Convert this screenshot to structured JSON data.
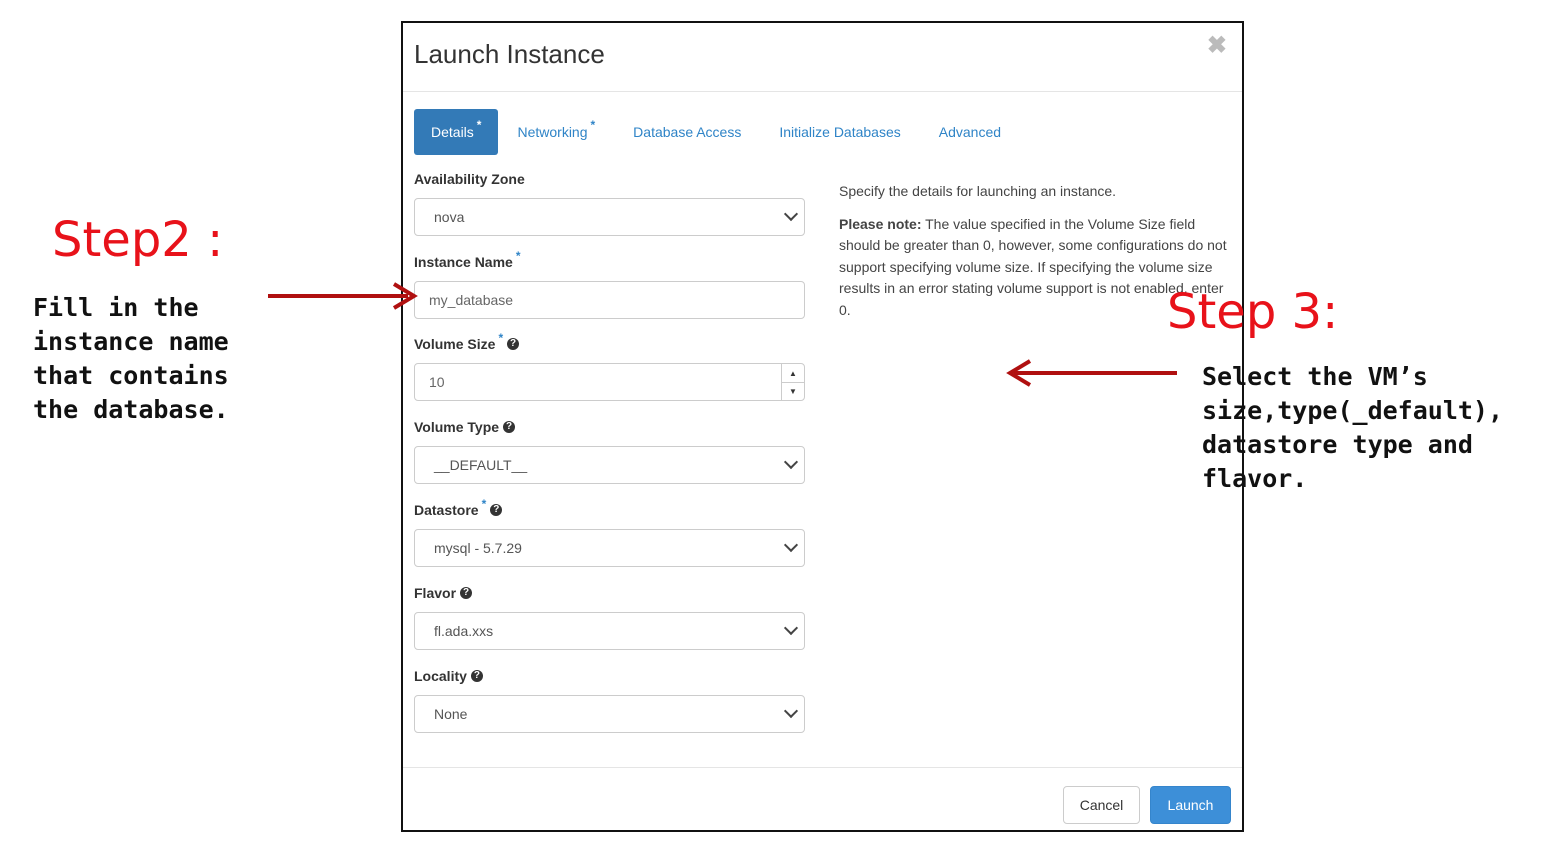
{
  "modal": {
    "title": "Launch Instance",
    "close_symbol": "✖",
    "tabs": [
      {
        "label": "Details",
        "required": "*",
        "active": true
      },
      {
        "label": "Networking",
        "required": "*",
        "active": false
      },
      {
        "label": "Database Access",
        "required": "",
        "active": false
      },
      {
        "label": "Initialize Databases",
        "required": "",
        "active": false
      },
      {
        "label": "Advanced",
        "required": "",
        "active": false
      }
    ],
    "fields": {
      "availability_zone": {
        "label": "Availability Zone",
        "value": "nova"
      },
      "instance_name": {
        "label": "Instance Name",
        "required": "*",
        "value": "my_database"
      },
      "volume_size": {
        "label": "Volume Size",
        "required": "*",
        "value": "10"
      },
      "volume_type": {
        "label": "Volume Type",
        "value": "__DEFAULT__"
      },
      "datastore": {
        "label": "Datastore",
        "required": "*",
        "value": "mysql - 5.7.29"
      },
      "flavor": {
        "label": "Flavor",
        "value": "fl.ada.xxs"
      },
      "locality": {
        "label": "Locality",
        "value": "None"
      }
    },
    "help_symbol": "?",
    "description": {
      "intro": "Specify the details for launching an instance.",
      "note_label": "Please note:",
      "note_text": " The value specified in the Volume Size field should be greater than 0, however, some configurations do not support specifying volume size. If specifying the volume size results in an error stating volume support is not enabled, enter 0."
    },
    "buttons": {
      "cancel": "Cancel",
      "launch": "Launch"
    }
  },
  "annotations": {
    "step2": {
      "title": "Step2 :",
      "text": "Fill in the\ninstance name\nthat contains\nthe database."
    },
    "step3": {
      "title": "Step 3:",
      "text": "Select the VM’s\nsize,type(_default),\ndatastore type and\nflavor."
    },
    "arrow_color": "#b01010",
    "title_color": "#e8121a"
  },
  "colors": {
    "primary": "#337ab7",
    "link": "#2f84c7"
  }
}
